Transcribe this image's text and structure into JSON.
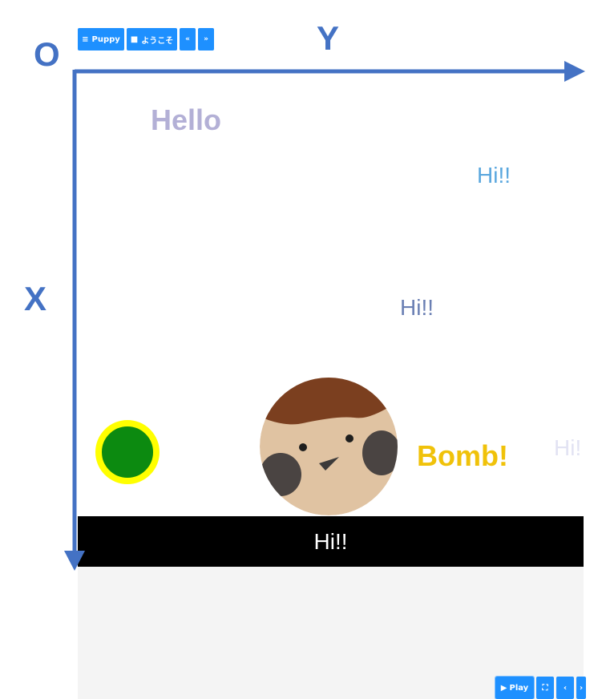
{
  "toolbar": {
    "puppy_label": "Puppy",
    "yokoso_label": "ようこそ",
    "prev_label": "«",
    "next_label": "»",
    "menu_icon": "≡",
    "folder_icon": "■"
  },
  "axes": {
    "origin_label": "O",
    "y_label": "Y",
    "x_label": "X",
    "color": "#4472c4"
  },
  "stage": {
    "texts": {
      "hello": "Hello",
      "hi_top_right": "Hi!!",
      "hi_middle": "Hi!!",
      "hi_faded": "Hi!",
      "bomb": "Bomb!",
      "bottom_bar": "Hi!!"
    },
    "colors": {
      "hello": "#b3b0d6",
      "hi_top_right": "#5aa7de",
      "hi_middle": "#6a7fb3",
      "hi_faded": "#e2e3f3",
      "bomb": "#f0c20a",
      "ball_fill": "#0c8a10",
      "ball_ring": "#ffff00",
      "bar": "#000000",
      "gray_area": "#f4f4f4"
    },
    "sprites": {
      "ball": "green-ball-sprite",
      "bird": "sparrow-face-sprite"
    }
  },
  "controls": {
    "play_icon": "▶",
    "play_label": "Play",
    "fullscreen_icon": "⛶",
    "prev_icon": "‹",
    "next_icon": "›"
  },
  "brand_colors": {
    "button": "#1e90ff"
  }
}
